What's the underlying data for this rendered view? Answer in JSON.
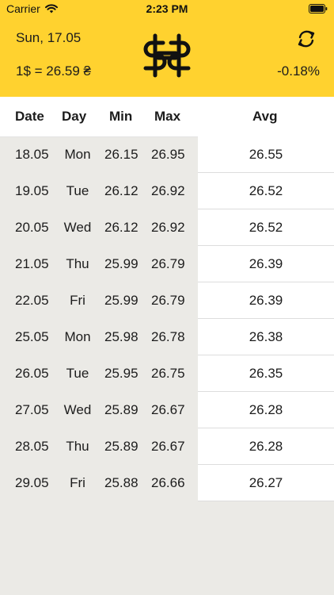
{
  "status": {
    "carrier": "Carrier",
    "time": "2:23 PM"
  },
  "header": {
    "date": "Sun, 17.05",
    "rate": "1$ = 26.59 ₴",
    "change": "-0.18%"
  },
  "table": {
    "columns": [
      "Date",
      "Day",
      "Min",
      "Max",
      "Avg"
    ],
    "rows": [
      {
        "date": "18.05",
        "day": "Mon",
        "min": "26.15",
        "max": "26.95",
        "avg": "26.55"
      },
      {
        "date": "19.05",
        "day": "Tue",
        "min": "26.12",
        "max": "26.92",
        "avg": "26.52"
      },
      {
        "date": "20.05",
        "day": "Wed",
        "min": "26.12",
        "max": "26.92",
        "avg": "26.52"
      },
      {
        "date": "21.05",
        "day": "Thu",
        "min": "25.99",
        "max": "26.79",
        "avg": "26.39"
      },
      {
        "date": "22.05",
        "day": "Fri",
        "min": "25.99",
        "max": "26.79",
        "avg": "26.39"
      },
      {
        "date": "25.05",
        "day": "Mon",
        "min": "25.98",
        "max": "26.78",
        "avg": "26.38"
      },
      {
        "date": "26.05",
        "day": "Tue",
        "min": "25.95",
        "max": "26.75",
        "avg": "26.35"
      },
      {
        "date": "27.05",
        "day": "Wed",
        "min": "25.89",
        "max": "26.67",
        "avg": "26.28"
      },
      {
        "date": "28.05",
        "day": "Thu",
        "min": "25.89",
        "max": "26.67",
        "avg": "26.28"
      },
      {
        "date": "29.05",
        "day": "Fri",
        "min": "25.88",
        "max": "26.66",
        "avg": "26.27"
      }
    ]
  },
  "colors": {
    "header_bg": "#ffd22f",
    "page_bg": "#ebeae6",
    "avg_bg": "#ffffff"
  },
  "icons": {
    "logo": "dollar-hryvnia-logo-icon",
    "refresh": "refresh-icon",
    "wifi": "wifi-icon",
    "battery": "battery-icon"
  }
}
